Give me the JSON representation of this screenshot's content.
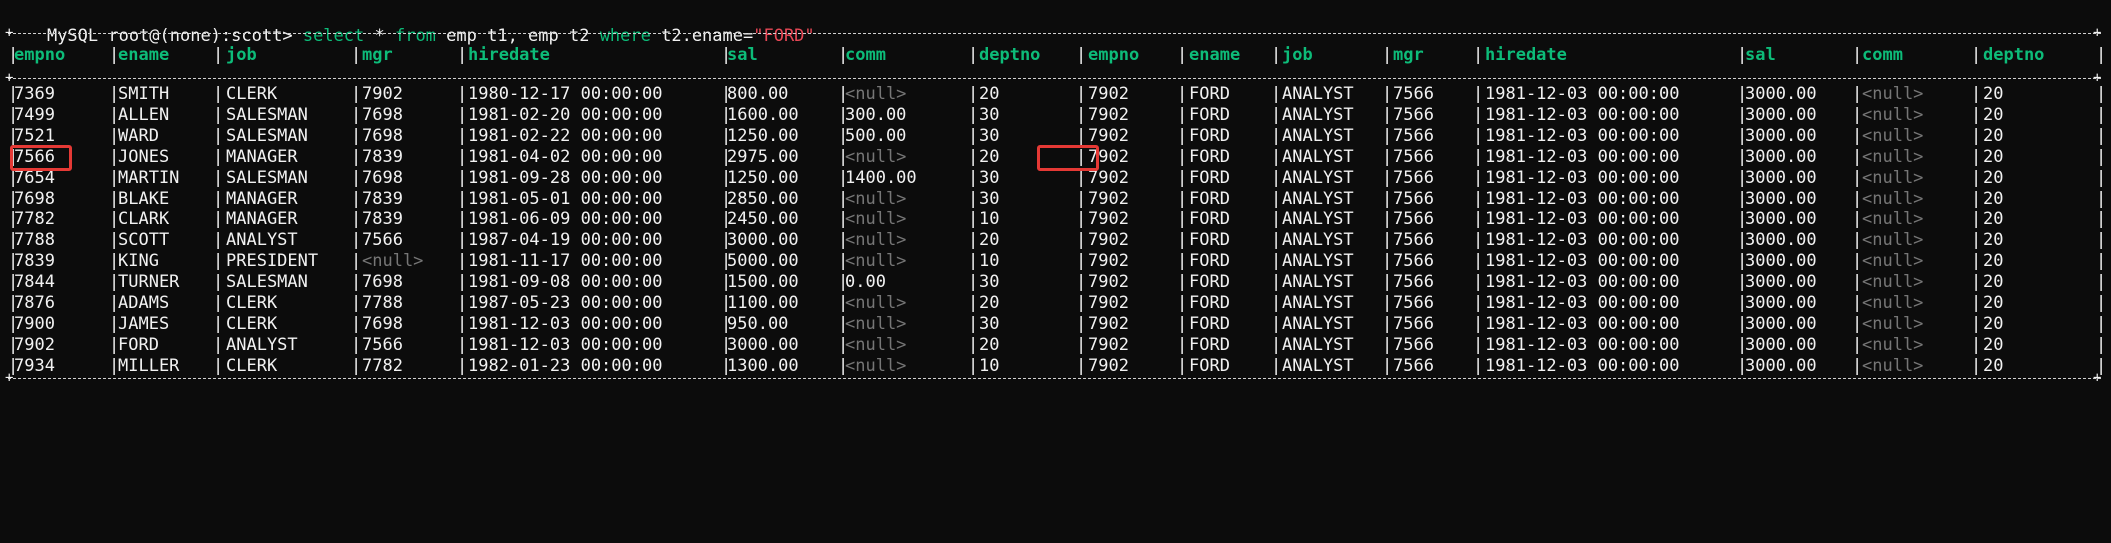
{
  "prompt": {
    "text": "MySQL root@(none):scott> ",
    "cmd_select": "select",
    "cmd_star": " * ",
    "cmd_from": "from",
    "cmd_tables": " emp t1, emp t2 ",
    "cmd_where": "where",
    "cmd_cond": " t2.ename=",
    "cmd_value": "\"FORD\""
  },
  "table": {
    "headers": [
      "empno",
      "ename",
      "job",
      "mgr",
      "hiredate",
      "sal",
      "comm",
      "deptno",
      "empno",
      "ename",
      "job",
      "mgr",
      "hiredate",
      "sal",
      "comm",
      "deptno"
    ],
    "rows": [
      [
        "7369",
        "SMITH",
        "CLERK",
        "7902",
        "1980-12-17 00:00:00",
        "800.00",
        "<null>",
        "20",
        "7902",
        "FORD",
        "ANALYST",
        "7566",
        "1981-12-03 00:00:00",
        "3000.00",
        "<null>",
        "20"
      ],
      [
        "7499",
        "ALLEN",
        "SALESMAN",
        "7698",
        "1981-02-20 00:00:00",
        "1600.00",
        "300.00",
        "30",
        "7902",
        "FORD",
        "ANALYST",
        "7566",
        "1981-12-03 00:00:00",
        "3000.00",
        "<null>",
        "20"
      ],
      [
        "7521",
        "WARD",
        "SALESMAN",
        "7698",
        "1981-02-22 00:00:00",
        "1250.00",
        "500.00",
        "30",
        "7902",
        "FORD",
        "ANALYST",
        "7566",
        "1981-12-03 00:00:00",
        "3000.00",
        "<null>",
        "20"
      ],
      [
        "7566",
        "JONES",
        "MANAGER",
        "7839",
        "1981-04-02 00:00:00",
        "2975.00",
        "<null>",
        "20",
        "7902",
        "FORD",
        "ANALYST",
        "7566",
        "1981-12-03 00:00:00",
        "3000.00",
        "<null>",
        "20"
      ],
      [
        "7654",
        "MARTIN",
        "SALESMAN",
        "7698",
        "1981-09-28 00:00:00",
        "1250.00",
        "1400.00",
        "30",
        "7902",
        "FORD",
        "ANALYST",
        "7566",
        "1981-12-03 00:00:00",
        "3000.00",
        "<null>",
        "20"
      ],
      [
        "7698",
        "BLAKE",
        "MANAGER",
        "7839",
        "1981-05-01 00:00:00",
        "2850.00",
        "<null>",
        "30",
        "7902",
        "FORD",
        "ANALYST",
        "7566",
        "1981-12-03 00:00:00",
        "3000.00",
        "<null>",
        "20"
      ],
      [
        "7782",
        "CLARK",
        "MANAGER",
        "7839",
        "1981-06-09 00:00:00",
        "2450.00",
        "<null>",
        "10",
        "7902",
        "FORD",
        "ANALYST",
        "7566",
        "1981-12-03 00:00:00",
        "3000.00",
        "<null>",
        "20"
      ],
      [
        "7788",
        "SCOTT",
        "ANALYST",
        "7566",
        "1987-04-19 00:00:00",
        "3000.00",
        "<null>",
        "20",
        "7902",
        "FORD",
        "ANALYST",
        "7566",
        "1981-12-03 00:00:00",
        "3000.00",
        "<null>",
        "20"
      ],
      [
        "7839",
        "KING",
        "PRESIDENT",
        "<null>",
        "1981-11-17 00:00:00",
        "5000.00",
        "<null>",
        "10",
        "7902",
        "FORD",
        "ANALYST",
        "7566",
        "1981-12-03 00:00:00",
        "3000.00",
        "<null>",
        "20"
      ],
      [
        "7844",
        "TURNER",
        "SALESMAN",
        "7698",
        "1981-09-08 00:00:00",
        "1500.00",
        "0.00",
        "30",
        "7902",
        "FORD",
        "ANALYST",
        "7566",
        "1981-12-03 00:00:00",
        "3000.00",
        "<null>",
        "20"
      ],
      [
        "7876",
        "ADAMS",
        "CLERK",
        "7788",
        "1987-05-23 00:00:00",
        "1100.00",
        "<null>",
        "20",
        "7902",
        "FORD",
        "ANALYST",
        "7566",
        "1981-12-03 00:00:00",
        "3000.00",
        "<null>",
        "20"
      ],
      [
        "7900",
        "JAMES",
        "CLERK",
        "7698",
        "1981-12-03 00:00:00",
        "950.00",
        "<null>",
        "30",
        "7902",
        "FORD",
        "ANALYST",
        "7566",
        "1981-12-03 00:00:00",
        "3000.00",
        "<null>",
        "20"
      ],
      [
        "7902",
        "FORD",
        "ANALYST",
        "7566",
        "1981-12-03 00:00:00",
        "3000.00",
        "<null>",
        "20",
        "7902",
        "FORD",
        "ANALYST",
        "7566",
        "1981-12-03 00:00:00",
        "3000.00",
        "<null>",
        "20"
      ],
      [
        "7934",
        "MILLER",
        "CLERK",
        "7782",
        "1982-01-23 00:00:00",
        "1300.00",
        "<null>",
        "10",
        "7902",
        "FORD",
        "ANALYST",
        "7566",
        "1981-12-03 00:00:00",
        "3000.00",
        "<null>",
        "20"
      ]
    ],
    "null_token": "<null>",
    "highlight": {
      "row_index": 3,
      "column_indices": [
        0,
        11
      ],
      "color": "#e53935"
    }
  },
  "colors": {
    "background": "#0c0c0c",
    "text": "#f2f2f2",
    "keyword": "#0dbc79",
    "header": "#0dbc79",
    "string": "#e74856",
    "null": "#767676"
  }
}
